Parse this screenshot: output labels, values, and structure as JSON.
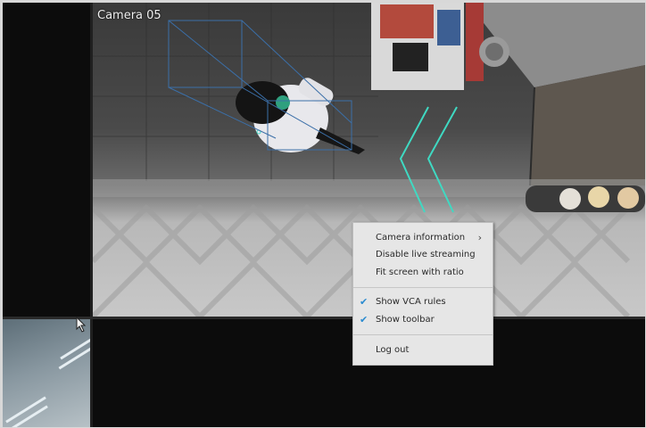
{
  "camera": {
    "title": "Camera 05"
  },
  "context_menu": {
    "items": [
      {
        "label": "Camera information",
        "has_submenu": true,
        "checked": false
      },
      {
        "label": "Disable live streaming",
        "has_submenu": false,
        "checked": false
      },
      {
        "label": "Fit screen with ratio",
        "has_submenu": false,
        "checked": false
      },
      {
        "label": "Show VCA rules",
        "has_submenu": false,
        "checked": true
      },
      {
        "label": "Show toolbar",
        "has_submenu": false,
        "checked": true
      },
      {
        "label": "Log out",
        "has_submenu": false,
        "checked": false
      }
    ],
    "submenu_glyph": "›",
    "check_glyph": "✔"
  },
  "colors": {
    "vca_line": "#3fd9c2",
    "tracker_box": "#3b6fa8",
    "check": "#2a8bd0"
  }
}
